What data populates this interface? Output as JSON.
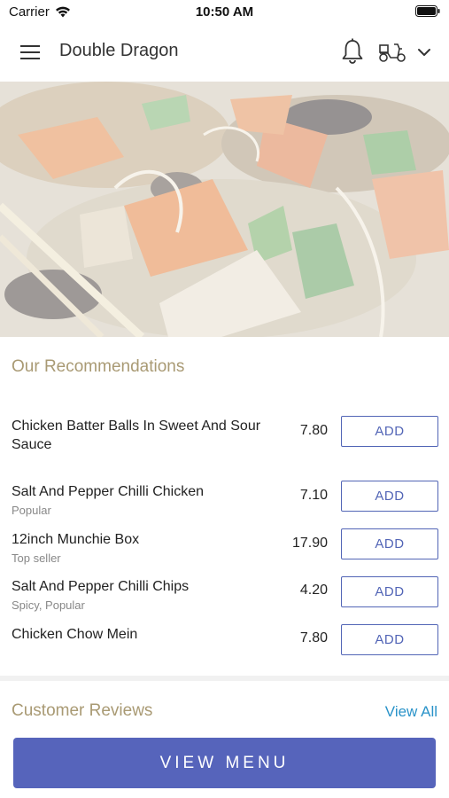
{
  "status_bar": {
    "carrier": "Carrier",
    "time": "10:50 AM"
  },
  "header": {
    "title": "Double Dragon"
  },
  "recommendations": {
    "title": "Our Recommendations",
    "items": [
      {
        "name": "Chicken Batter Balls In Sweet And Sour Sauce",
        "subtitle": "",
        "price": "7.80",
        "button": "ADD"
      },
      {
        "name": "Salt And Pepper Chilli Chicken",
        "subtitle": "Popular",
        "price": "7.10",
        "button": "ADD"
      },
      {
        "name": "12inch Munchie Box",
        "subtitle": "Top seller",
        "price": "17.90",
        "button": "ADD"
      },
      {
        "name": "Salt And Pepper Chilli Chips",
        "subtitle": "Spicy, Popular",
        "price": "4.20",
        "button": "ADD"
      },
      {
        "name": "Chicken Chow Mein",
        "subtitle": "",
        "price": "7.80",
        "button": "ADD"
      }
    ]
  },
  "reviews": {
    "title": "Customer Reviews",
    "view_all": "View All"
  },
  "footer": {
    "view_menu": "VIEW MENU"
  },
  "colors": {
    "accent": "#5664bb",
    "section_title": "#a99a74",
    "link": "#2a93c9"
  }
}
